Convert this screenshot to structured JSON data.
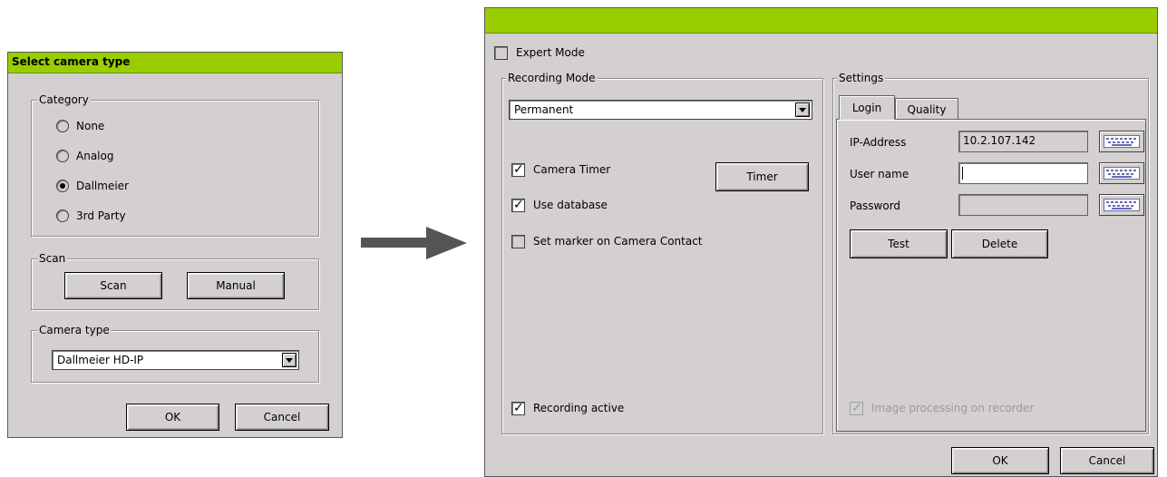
{
  "left_dialog": {
    "title": "Select camera type",
    "category": {
      "label": "Category",
      "options": [
        {
          "label": "None",
          "selected": false
        },
        {
          "label": "Analog",
          "selected": false
        },
        {
          "label": "Dallmeier",
          "selected": true
        },
        {
          "label": "3rd Party",
          "selected": false
        }
      ]
    },
    "scan": {
      "label": "Scan",
      "scan_button": "Scan",
      "manual_button": "Manual"
    },
    "camera_type": {
      "label": "Camera type",
      "selected": "Dallmeier HD-IP"
    },
    "ok_button": "OK",
    "cancel_button": "Cancel"
  },
  "arrow_icon": "right-arrow-icon",
  "right_dialog": {
    "title": "",
    "expert_mode": {
      "label": "Expert Mode",
      "checked": false
    },
    "recording_mode": {
      "label": "Recording Mode",
      "selected": "Permanent",
      "camera_timer": {
        "label": "Camera Timer",
        "checked": true
      },
      "timer_button": "Timer",
      "use_database": {
        "label": "Use database",
        "checked": true
      },
      "set_marker": {
        "label": "Set marker on Camera Contact",
        "checked": false
      },
      "recording_active": {
        "label": "Recording active",
        "checked": true
      }
    },
    "settings": {
      "label": "Settings",
      "tabs": [
        {
          "label": "Login",
          "active": true
        },
        {
          "label": "Quality",
          "active": false
        }
      ],
      "ip_label": "IP-Address",
      "ip_value": "10.2.107.142",
      "user_label": "User name",
      "user_value": "",
      "password_label": "Password",
      "password_value": "",
      "test_button": "Test",
      "delete_button": "Delete",
      "image_processing": {
        "label": "Image processing on recorder",
        "checked": true,
        "disabled": true
      }
    },
    "ok_button": "OK",
    "cancel_button": "Cancel"
  },
  "colors": {
    "title_bar": "#9acd00",
    "dialog_bg": "#d4d0d0"
  }
}
